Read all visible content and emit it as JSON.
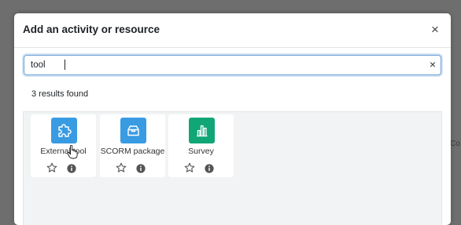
{
  "backdrop": {
    "right_edge_text": "Co"
  },
  "modal": {
    "title": "Add an activity or resource",
    "close_symbol": "×"
  },
  "search": {
    "value": "tool",
    "clear_symbol": "×"
  },
  "results": {
    "count_text": "3 results found",
    "items": [
      {
        "label": "External tool",
        "icon": "puzzle-piece-icon",
        "color": "#399be2"
      },
      {
        "label": "SCORM package",
        "icon": "package-box-icon",
        "color": "#399be2"
      },
      {
        "label": "Survey",
        "icon": "bar-chart-icon",
        "color": "#11a676"
      }
    ]
  },
  "colors": {
    "backdrop": "#6e6e6e",
    "focus_border": "#6a9fd4",
    "results_background": "#f1f3f4"
  }
}
